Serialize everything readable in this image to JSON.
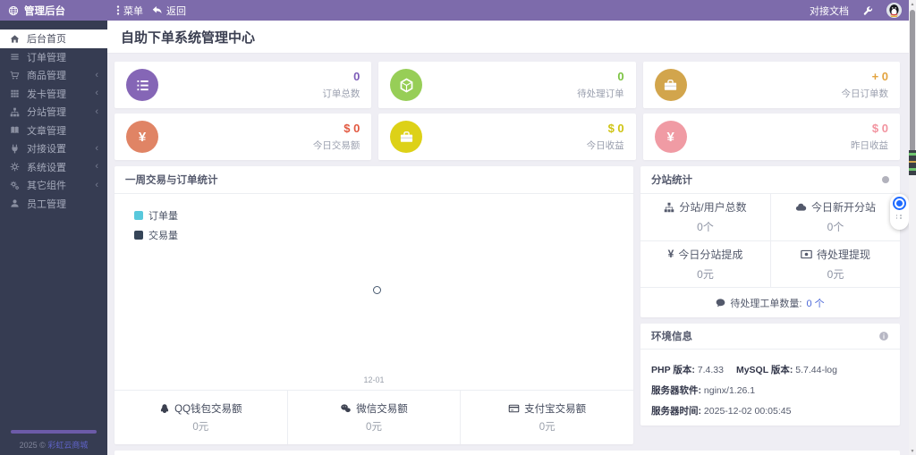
{
  "topbar": {
    "brand": "管理后台",
    "menu_label": "菜单",
    "back_label": "返回",
    "docs_label": "对接文档"
  },
  "sidebar": {
    "items": [
      {
        "label": "后台首页"
      },
      {
        "label": "订单管理"
      },
      {
        "label": "商品管理"
      },
      {
        "label": "发卡管理"
      },
      {
        "label": "分站管理"
      },
      {
        "label": "文章管理"
      },
      {
        "label": "对接设置"
      },
      {
        "label": "系统设置"
      },
      {
        "label": "其它组件"
      },
      {
        "label": "员工管理"
      }
    ],
    "chevron": "‹",
    "footer_year": "2025 ©",
    "footer_link": "彩虹云商城"
  },
  "page": {
    "title": "自助下单系统管理中心"
  },
  "colors": {
    "topbar": "#7d6bab",
    "sidebar": "#363c52",
    "link_blue": "#4a67d8",
    "card_accents": [
      "#8566b6",
      "#97ce57",
      "#d2a54c",
      "#e08465",
      "#ddd117",
      "#f09ba4"
    ]
  },
  "stat_cards": [
    {
      "value": "0",
      "label": "订单总数",
      "icon": "ordered-list-icon"
    },
    {
      "value": "0",
      "label": "待处理订单",
      "icon": "cube-icon"
    },
    {
      "value": "+ 0",
      "label": "今日订单数",
      "icon": "briefcase-icon"
    },
    {
      "value": "$ 0",
      "label": "今日交易额",
      "icon": "yen-icon"
    },
    {
      "value": "$ 0",
      "label": "今日收益",
      "icon": "briefcase-icon"
    },
    {
      "value": "$ 0",
      "label": "昨日收益",
      "icon": "yen-icon"
    }
  ],
  "chart_panel": {
    "title": "一周交易与订单统计"
  },
  "chart_data": {
    "type": "line",
    "x": [
      "12-01"
    ],
    "series": [
      {
        "name": "订单量",
        "color": "#58c8dc",
        "values": [
          0
        ]
      },
      {
        "name": "交易量",
        "color": "#364558",
        "values": [
          0
        ]
      }
    ],
    "title": "一周交易与订单统计",
    "xlabel": "",
    "ylabel": "",
    "legend_position": "left",
    "grid": false
  },
  "pay_stats": [
    {
      "label": "QQ钱包交易额",
      "value": "0元",
      "icon": "qq-icon"
    },
    {
      "label": "微信交易额",
      "value": "0元",
      "icon": "wechat-icon"
    },
    {
      "label": "支付宝交易额",
      "value": "0元",
      "icon": "credit-card-icon"
    }
  ],
  "substation": {
    "title": "分站统计",
    "cells": [
      {
        "label": "分站/用户总数",
        "value": "0个",
        "icon": "sitemap-icon"
      },
      {
        "label": "今日新开分站",
        "value": "0个",
        "icon": "cloud-icon"
      },
      {
        "label": "今日分站提成",
        "value": "0元",
        "icon": "yen-icon"
      },
      {
        "label": "待处理提现",
        "value": "0元",
        "icon": "money-icon"
      }
    ],
    "ticket_label": "待处理工单数量:",
    "ticket_value": "0 个"
  },
  "env": {
    "title": "环境信息",
    "php_label": "PHP 版本:",
    "php_value": "7.4.33",
    "mysql_label": "MySQL 版本:",
    "mysql_value": "5.7.44-log",
    "server_label": "服务器软件:",
    "server_value": "nginx/1.26.1",
    "time_label": "服务器时间:",
    "time_value": "2025-12-02 00:05:45"
  }
}
